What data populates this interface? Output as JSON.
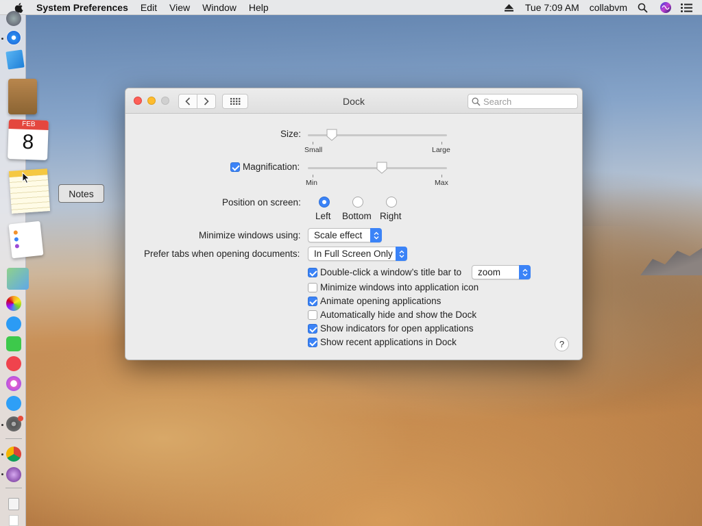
{
  "menubar": {
    "app_name": "System Preferences",
    "items": [
      "Edit",
      "View",
      "Window",
      "Help"
    ],
    "clock": "Tue 7:09 AM",
    "user": "collabvm"
  },
  "dock": {
    "calendar_month": "FEB",
    "calendar_day": "8",
    "tooltip": "Notes"
  },
  "window": {
    "title": "Dock",
    "search_placeholder": "Search",
    "size": {
      "label": "Size:",
      "min_label": "Small",
      "max_label": "Large",
      "value": 0.17
    },
    "magnification": {
      "label": "Magnification:",
      "checked": true,
      "min_label": "Min",
      "max_label": "Max",
      "value": 0.53
    },
    "position": {
      "label": "Position on screen:",
      "options": [
        "Left",
        "Bottom",
        "Right"
      ],
      "selected": "Left"
    },
    "minimize_using": {
      "label": "Minimize windows using:",
      "value": "Scale effect"
    },
    "prefer_tabs": {
      "label": "Prefer tabs when opening documents:",
      "value": "In Full Screen Only"
    },
    "double_click": {
      "label": "Double-click a window’s title bar to",
      "value": "zoom",
      "checked": true
    },
    "checkboxes": [
      {
        "label": "Minimize windows into application icon",
        "checked": false
      },
      {
        "label": "Animate opening applications",
        "checked": true
      },
      {
        "label": "Automatically hide and show the Dock",
        "checked": false
      },
      {
        "label": "Show indicators for open applications",
        "checked": true
      },
      {
        "label": "Show recent applications in Dock",
        "checked": true
      }
    ],
    "help_label": "?"
  },
  "colors": {
    "accent": "#3b83f7",
    "close": "#fd5f57",
    "minimize": "#febc2e"
  }
}
